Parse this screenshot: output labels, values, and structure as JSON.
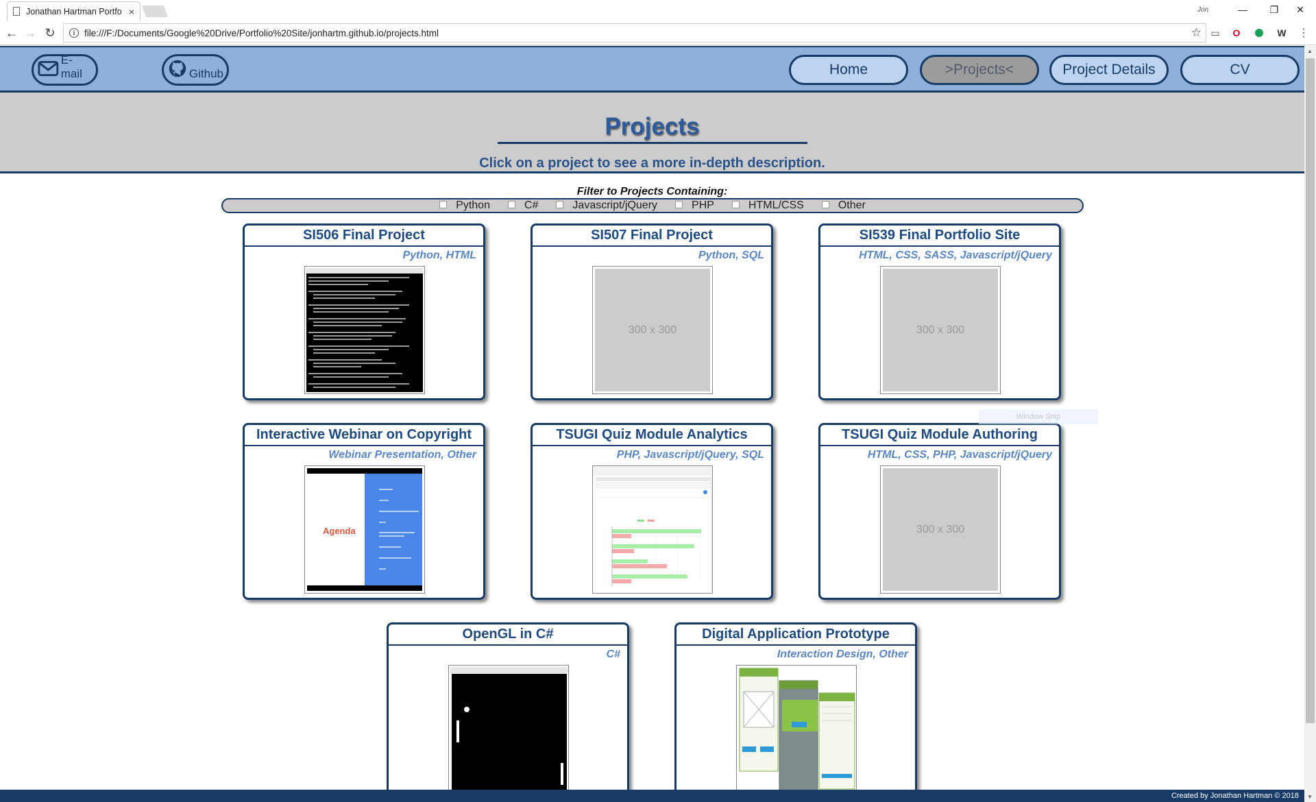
{
  "browser": {
    "tab_title": "Jonathan Hartman Portfo",
    "tab_close": "×",
    "url": "file:///F:/Documents/Google%20Drive/Portfolio%20Site/jonhartm.github.io/projects.html",
    "user_label": "Jon",
    "window_snip": "Window Snip"
  },
  "nav": {
    "email_label": "E-mail",
    "github_label": "Github",
    "pills": [
      {
        "label": "Home",
        "active": false
      },
      {
        "label": ">Projects<",
        "active": true
      },
      {
        "label": "Project Details",
        "active": false
      },
      {
        "label": "CV",
        "active": false
      }
    ]
  },
  "header": {
    "title": "Projects",
    "subtitle": "Click on a project to see a more in-depth description."
  },
  "filter": {
    "label": "Filter to Projects Containing:",
    "options": [
      "Python",
      "C#",
      "Javascript/jQuery",
      "PHP",
      "HTML/CSS",
      "Other"
    ]
  },
  "projects": [
    {
      "title": "SI506 Final Project",
      "tags": "Python, HTML",
      "thumb": "terminal"
    },
    {
      "title": "SI507 Final Project",
      "tags": "Python, SQL",
      "thumb": "placeholder",
      "placeholder_text": "300 x 300"
    },
    {
      "title": "SI539 Final Portfolio Site",
      "tags": "HTML, CSS, SASS, Javascript/jQuery",
      "thumb": "placeholder",
      "placeholder_text": "300 x 300"
    },
    {
      "title": "Interactive Webinar on Copyright",
      "tags": "Webinar Presentation, Other",
      "thumb": "agenda",
      "agenda_title": "Agenda"
    },
    {
      "title": "TSUGI Quiz Module Analytics",
      "tags": "PHP, Javascript/jQuery, SQL",
      "thumb": "chart"
    },
    {
      "title": "TSUGI Quiz Module Authoring",
      "tags": "HTML, CSS, PHP, Javascript/jQuery",
      "thumb": "placeholder",
      "placeholder_text": "300 x 300"
    },
    {
      "title": "OpenGL in C#",
      "tags": "C#",
      "thumb": "pong"
    },
    {
      "title": "Digital Application Prototype",
      "tags": "Interaction Design, Other",
      "thumb": "prototype"
    }
  ],
  "footer": {
    "text": "Created by Jonathan Hartman © 2018"
  },
  "colors": {
    "nav_bg": "#8fb0d8",
    "dark_navy": "#173a66",
    "pill_bg": "#bcd4f0",
    "header_bg": "#cccccc",
    "tag_blue": "#5a86c4"
  }
}
